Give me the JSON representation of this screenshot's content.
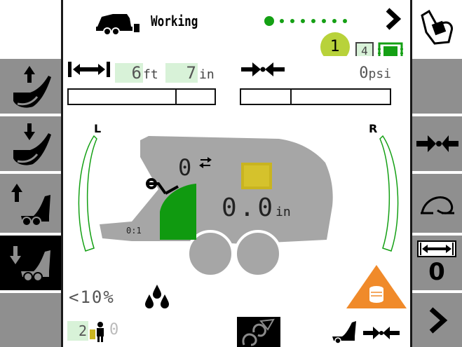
{
  "header": {
    "status_text": "Working",
    "step_badge": "1",
    "count_box": "4",
    "progress_dots": 8,
    "next_label": "›"
  },
  "bale_size": {
    "feet_value": "6",
    "feet_unit": "ft",
    "inches_value": "7",
    "inches_unit": "in",
    "fill": 0.73
  },
  "pressure": {
    "value": "0",
    "unit": "psi",
    "fill": 0.33
  },
  "gauges": {
    "left_label": "L",
    "right_label": "R"
  },
  "baler": {
    "net_wraps": "0",
    "diameter_value": "0.0",
    "diameter_unit": "in",
    "ratio": "0:1"
  },
  "moisture": {
    "value": "<10%"
  },
  "footer": {
    "bale_count": "2",
    "operator_count": "0"
  },
  "right_panel": {
    "offset_value": "0"
  },
  "colors": {
    "accent_green": "#14a014",
    "button_gray": "#8f8f8f",
    "baler_gray": "#a6a6a6",
    "warning_orange": "#f08a2a"
  }
}
